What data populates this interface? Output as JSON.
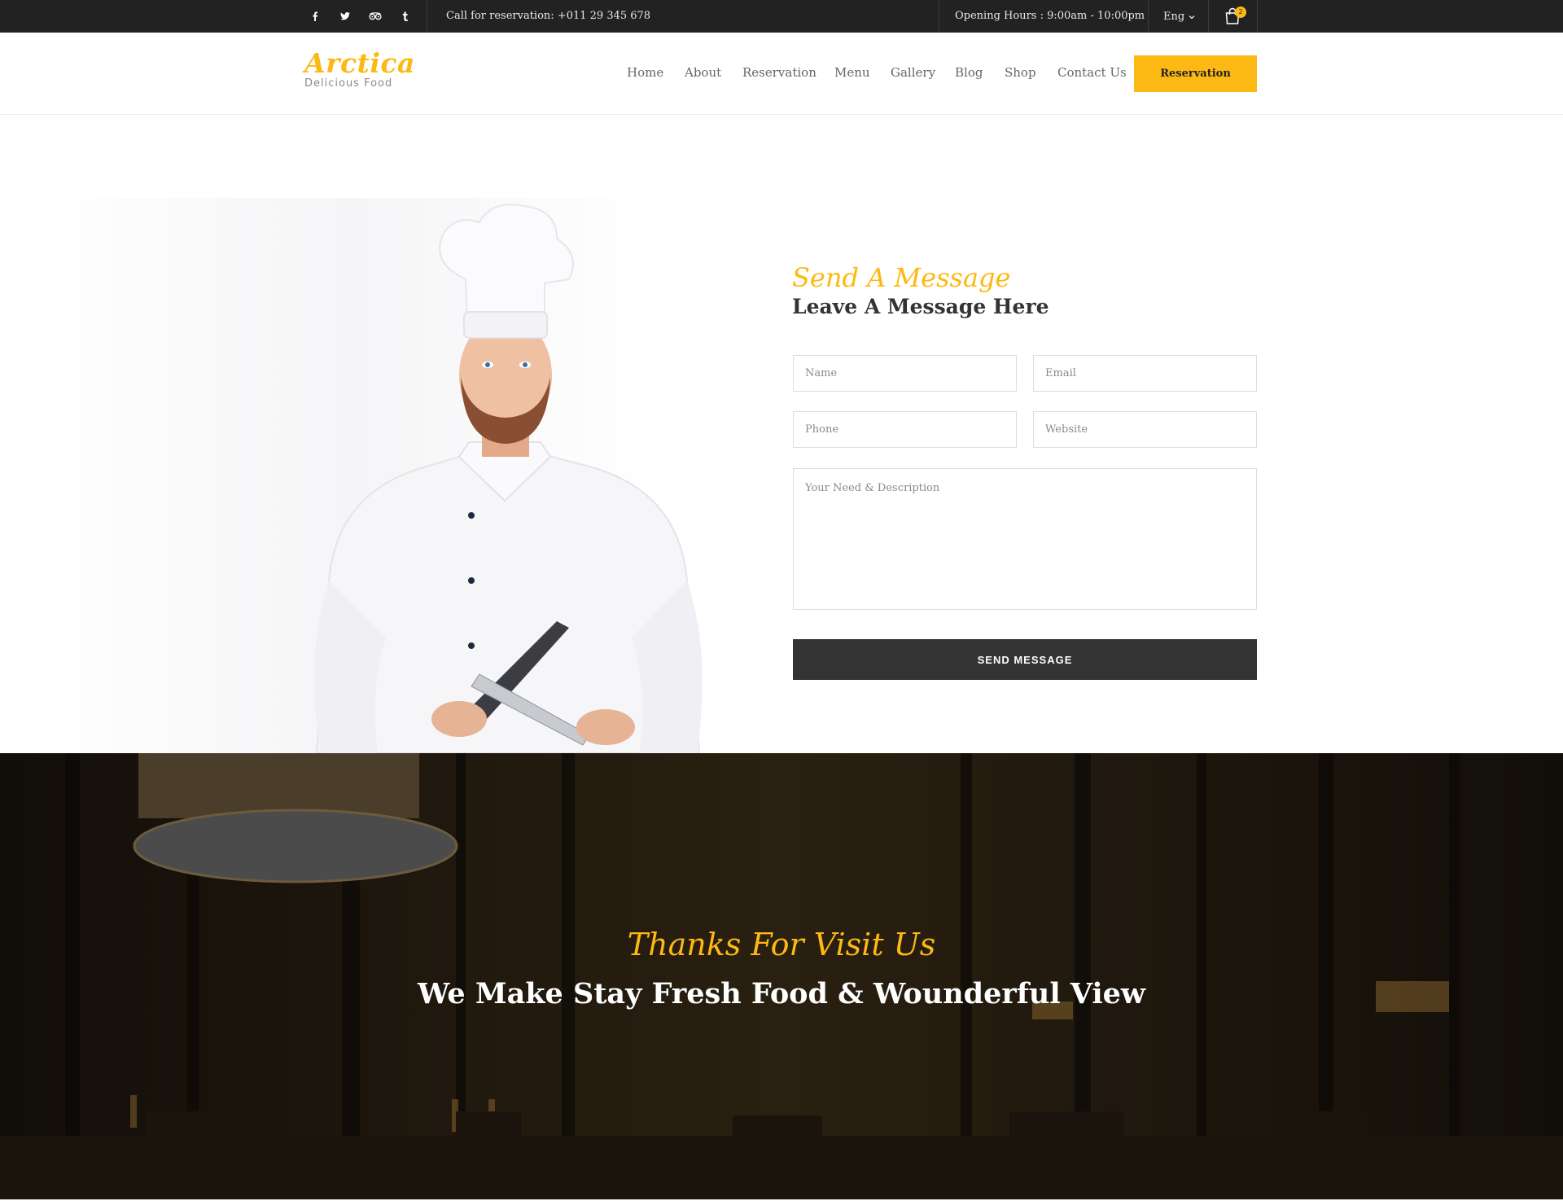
{
  "topbar": {
    "social_icons": [
      "facebook-icon",
      "twitter-icon",
      "tripadvisor-icon",
      "tumblr-icon"
    ],
    "phone": "Call for reservation: +011 29 345 678",
    "hours": "Opening Hours : 9:00am - 10:00pm",
    "language": "Eng",
    "cart_count": "2"
  },
  "header": {
    "brand": "Arctica",
    "tagline": "Delicious Food",
    "nav": [
      "Home",
      "About",
      "Reservation",
      "Menu",
      "Gallery",
      "Blog",
      "Shop",
      "Contact Us"
    ],
    "cta": "Reservation"
  },
  "contact": {
    "script_title": "Send A Message",
    "title": "Leave A Message Here",
    "placeholders": {
      "name": "Name",
      "email": "Email",
      "phone": "Phone",
      "website": "Website",
      "description": "Your Need & Description"
    },
    "submit": "SEND MESSAGE"
  },
  "banner": {
    "script_title": "Thanks For Visit Us",
    "title": "We Make Stay Fresh Food & Wounderful View"
  },
  "colors": {
    "accent": "#fdb913",
    "dark": "#222222",
    "button_dark": "#333333"
  }
}
